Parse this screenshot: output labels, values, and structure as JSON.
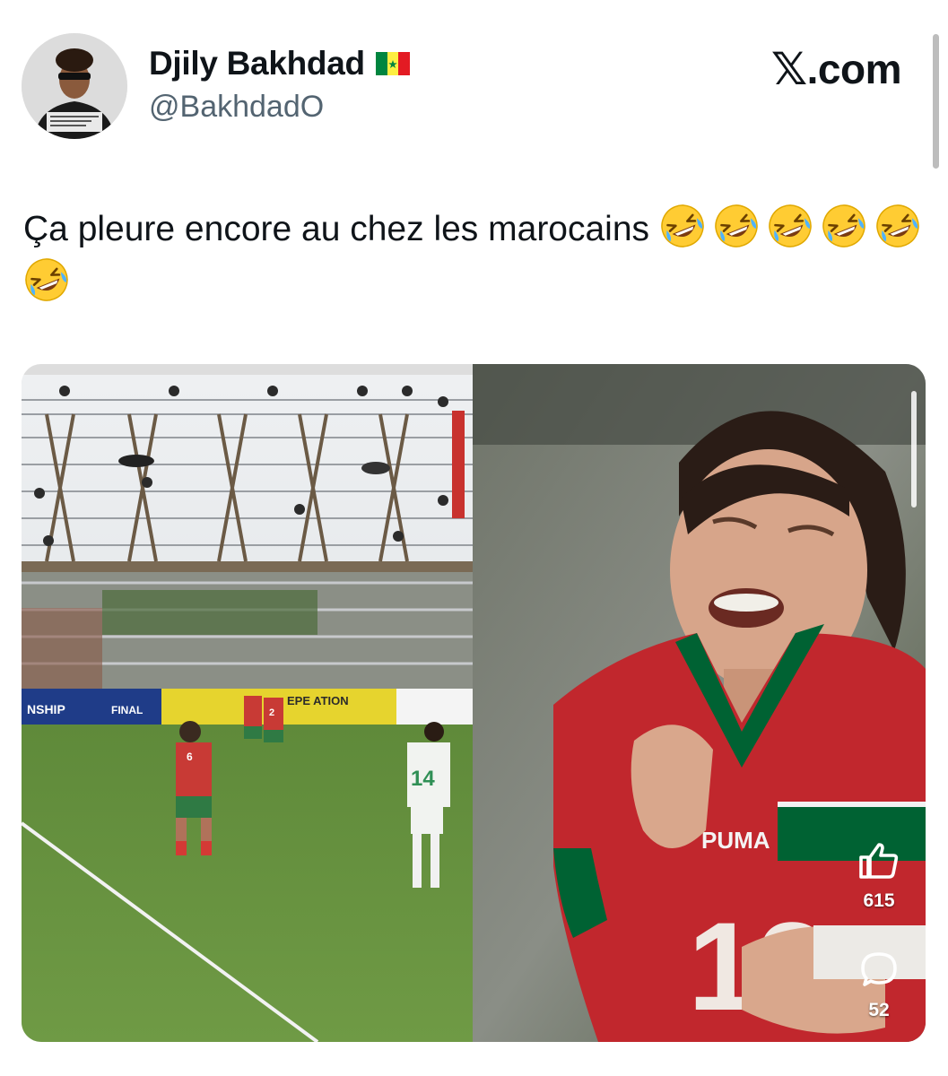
{
  "author": {
    "display_name": "Djily Bakhdad",
    "handle": "@BakhdadO",
    "flag_icon": "senegal-flag-icon",
    "avatar_icon": "profile-avatar"
  },
  "brand": {
    "x_glyph": "𝕏",
    "domain": ".com"
  },
  "tweet": {
    "text": "Ça pleure encore au chez les marocains",
    "emoji_icon": "rolling-on-the-floor-laughing-emoji",
    "emoji_count": 6
  },
  "media": {
    "stadium_photo": {
      "banner_left": "NSHIP",
      "banner_mid": "FINAL",
      "banner_yellow": "EPE\nATION",
      "player_number_front": "6",
      "player_number_white": "14",
      "player_number_red": "2"
    },
    "reel": {
      "jersey_brand": "PUMA",
      "jersey_number": "13",
      "like_count": "615",
      "comment_count": "52"
    }
  },
  "colors": {
    "text_primary": "#0f1419",
    "text_secondary": "#536471",
    "morocco_red": "#c1272d",
    "morocco_green": "#006233"
  }
}
